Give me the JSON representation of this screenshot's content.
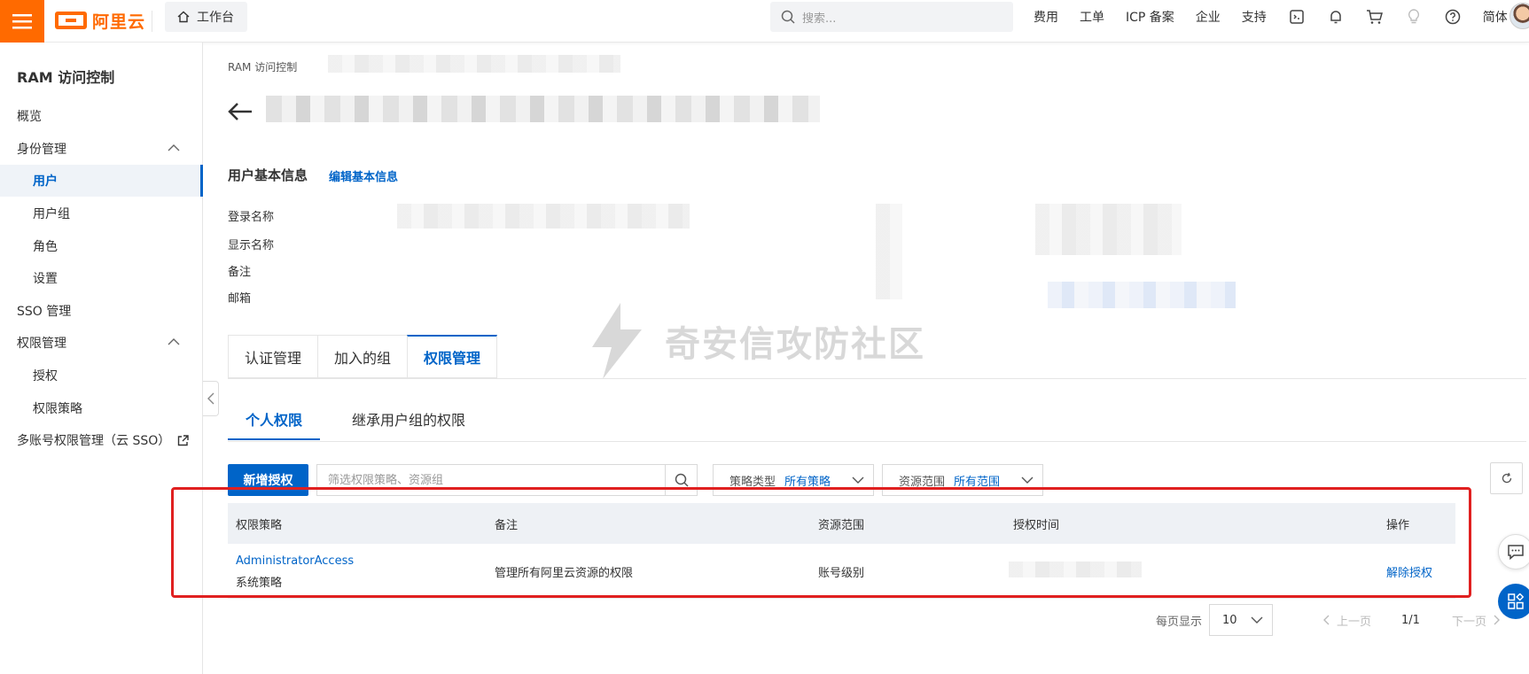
{
  "topbar": {
    "logo_text": "阿里云",
    "workbench": "工作台",
    "search_placeholder": "搜索...",
    "nav": [
      "费用",
      "工单",
      "ICP 备案",
      "企业",
      "支持"
    ],
    "lang": "简体"
  },
  "sidebar": {
    "title": "RAM 访问控制",
    "items": [
      {
        "label": "概览"
      },
      {
        "label": "身份管理"
      },
      {
        "label": "用户"
      },
      {
        "label": "用户组"
      },
      {
        "label": "角色"
      },
      {
        "label": "设置"
      },
      {
        "label": "SSO 管理"
      },
      {
        "label": "权限管理"
      },
      {
        "label": "授权"
      },
      {
        "label": "权限策略"
      },
      {
        "label": "多账号权限管理（云 SSO）"
      }
    ]
  },
  "main": {
    "breadcrumb": "RAM 访问控制",
    "section_title": "用户基本信息",
    "edit_link": "编辑基本信息",
    "fields": [
      "登录名称",
      "显示名称",
      "备注",
      "邮箱"
    ],
    "watermark": "奇安信攻防社区",
    "tabs": [
      "认证管理",
      "加入的组",
      "权限管理"
    ],
    "subtabs": [
      "个人权限",
      "继承用户组的权限"
    ],
    "add_button": "新增授权",
    "filter_placeholder": "筛选权限策略、资源组",
    "policy_type": {
      "label": "策略类型",
      "value": "所有策略"
    },
    "resource_scope": {
      "label": "资源范围",
      "value": "所有范围"
    },
    "table": {
      "headers": [
        "权限策略",
        "备注",
        "资源范围",
        "授权时间",
        "操作"
      ],
      "rows": [
        {
          "policy": "AdministratorAccess",
          "policy_type": "系统策略",
          "note": "管理所有阿里云资源的权限",
          "scope": "账号级别",
          "action": "解除授权"
        }
      ]
    },
    "pager": {
      "label": "每页显示",
      "size": "10",
      "prev": "上一页",
      "page": "1/1",
      "next": "下一页"
    }
  },
  "colors": {
    "brand": "#ff6a00",
    "primary": "#0064c8",
    "highlight": "#e02020"
  }
}
